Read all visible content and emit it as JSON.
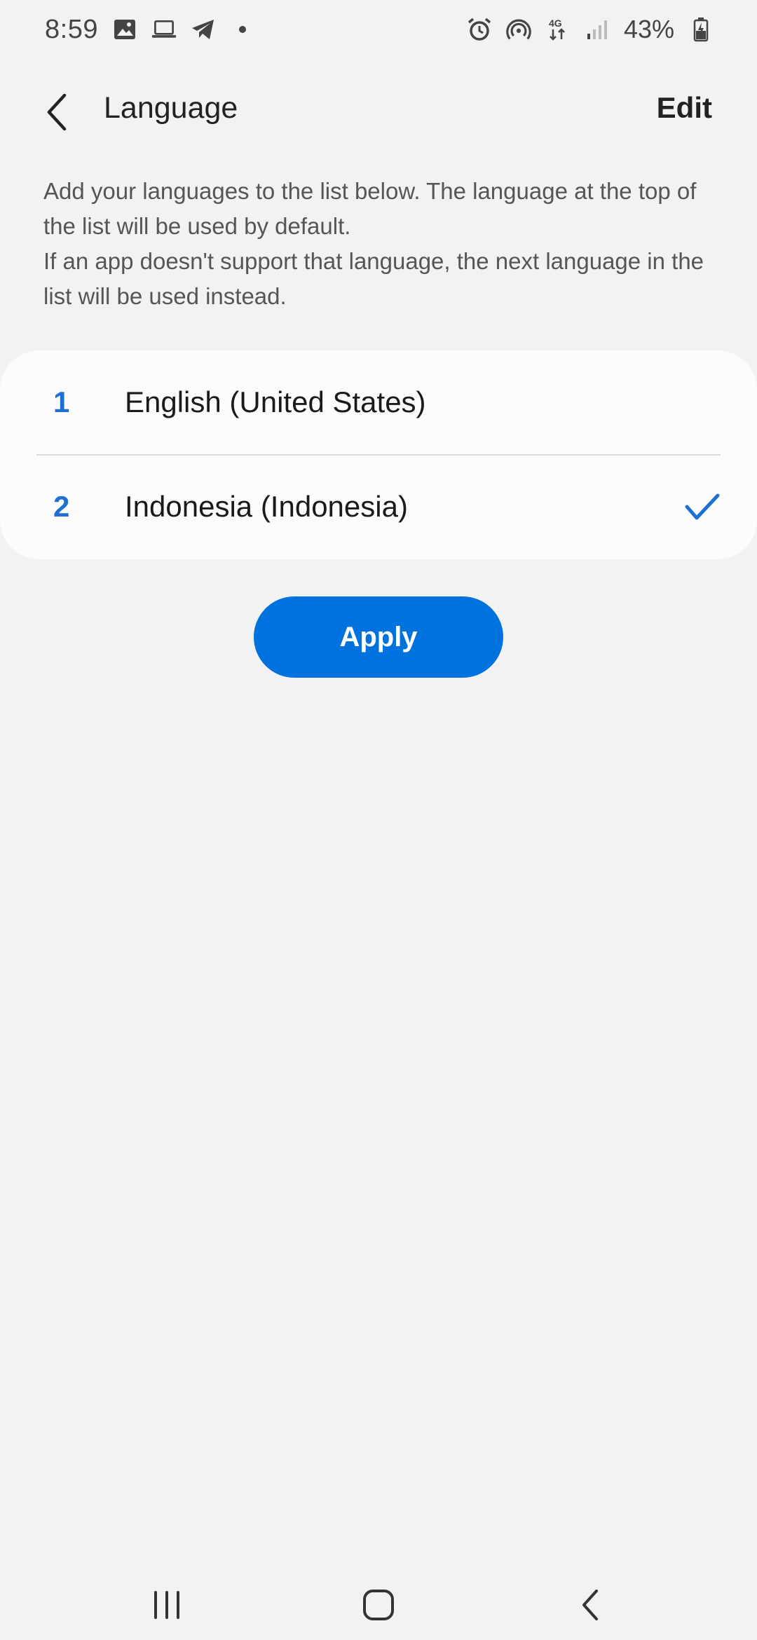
{
  "status_bar": {
    "time": "8:59",
    "left_icons": [
      "gallery-icon",
      "laptop-icon",
      "telegram-icon",
      "notification-dot-icon"
    ],
    "right_icons": [
      "alarm-icon",
      "hotspot-icon",
      "4g-icon",
      "signal-icon",
      "battery-icon"
    ],
    "network_label": "4G",
    "battery": "43%"
  },
  "app_bar": {
    "title": "Language",
    "edit_label": "Edit"
  },
  "description": {
    "line1": "Add your languages to the list below. The language at the top of the list will be used by default.",
    "line2": "If an app doesn't support that language, the next language in the list will be used instead."
  },
  "languages": [
    {
      "number": "1",
      "name": "English (United States)",
      "selected": false
    },
    {
      "number": "2",
      "name": "Indonesia (Indonesia)",
      "selected": true
    }
  ],
  "apply_label": "Apply",
  "colors": {
    "accent": "#0072de",
    "number": "#1d6fd1",
    "background": "#f2f2f2",
    "card": "#fcfcfc"
  }
}
